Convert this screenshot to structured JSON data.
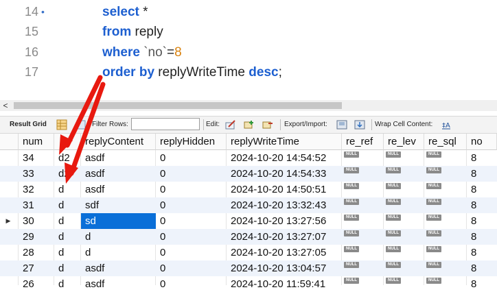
{
  "editor": {
    "lines": [
      {
        "num": "14",
        "marker": "•",
        "tokens": [
          {
            "t": "select",
            "c": "kw"
          },
          {
            "t": " *",
            "c": "id"
          }
        ]
      },
      {
        "num": "15",
        "marker": "",
        "tokens": [
          {
            "t": "from",
            "c": "kw"
          },
          {
            "t": " reply",
            "c": "id"
          }
        ]
      },
      {
        "num": "16",
        "marker": "",
        "tokens": [
          {
            "t": "where",
            "c": "kw"
          },
          {
            "t": " `no`",
            "c": "bt"
          },
          {
            "t": "=",
            "c": "id"
          },
          {
            "t": "8",
            "c": "num"
          }
        ]
      },
      {
        "num": "17",
        "marker": "",
        "tokens": [
          {
            "t": "order by",
            "c": "kw"
          },
          {
            "t": " replyWriteTime ",
            "c": "id"
          },
          {
            "t": "desc",
            "c": "kw"
          },
          {
            "t": ";",
            "c": "id"
          }
        ]
      }
    ]
  },
  "scrollbar": {
    "left_arrow": "<"
  },
  "toolbar": {
    "result_grid": "Result Grid",
    "filter_rows": "Filter Rows:",
    "edit": "Edit:",
    "export_import": "Export/Import:",
    "wrap": "Wrap Cell Content:"
  },
  "grid": {
    "columns": [
      "num",
      "",
      "replyContent",
      "replyHidden",
      "replyWriteTime",
      "re_ref",
      "re_lev",
      "re_sql",
      "no"
    ],
    "null_label": "NULL",
    "current_row_marker": "▶",
    "rows": [
      [
        "34",
        "d2",
        "asdf",
        "0",
        "2024-10-20 14:54:52",
        "NULL",
        "NULL",
        "NULL",
        "8"
      ],
      [
        "33",
        "d2",
        "asdf",
        "0",
        "2024-10-20 14:54:33",
        "NULL",
        "NULL",
        "NULL",
        "8"
      ],
      [
        "32",
        "d",
        "asdf",
        "0",
        "2024-10-20 14:50:51",
        "NULL",
        "NULL",
        "NULL",
        "8"
      ],
      [
        "31",
        "d",
        "sdf",
        "0",
        "2024-10-20 13:32:43",
        "NULL",
        "NULL",
        "NULL",
        "8"
      ],
      [
        "30",
        "d",
        "sd",
        "0",
        "2024-10-20 13:27:56",
        "NULL",
        "NULL",
        "NULL",
        "8"
      ],
      [
        "29",
        "d",
        "d",
        "0",
        "2024-10-20 13:27:07",
        "NULL",
        "NULL",
        "NULL",
        "8"
      ],
      [
        "28",
        "d",
        "d",
        "0",
        "2024-10-20 13:27:05",
        "NULL",
        "NULL",
        "NULL",
        "8"
      ],
      [
        "27",
        "d",
        "asdf",
        "0",
        "2024-10-20 13:04:57",
        "NULL",
        "NULL",
        "NULL",
        "8"
      ],
      [
        "26",
        "d",
        "asdf",
        "0",
        "2024-10-20 11:59:41",
        "NULL",
        "NULL",
        "NULL",
        "8"
      ]
    ],
    "current_row_index": 4,
    "selected_cell": {
      "row": 4,
      "col": 2
    }
  },
  "colors": {
    "keyword": "#1d5fd0",
    "number": "#d9820f",
    "selection": "#0a6fd8",
    "annotation_arrow": "#e8190f"
  }
}
